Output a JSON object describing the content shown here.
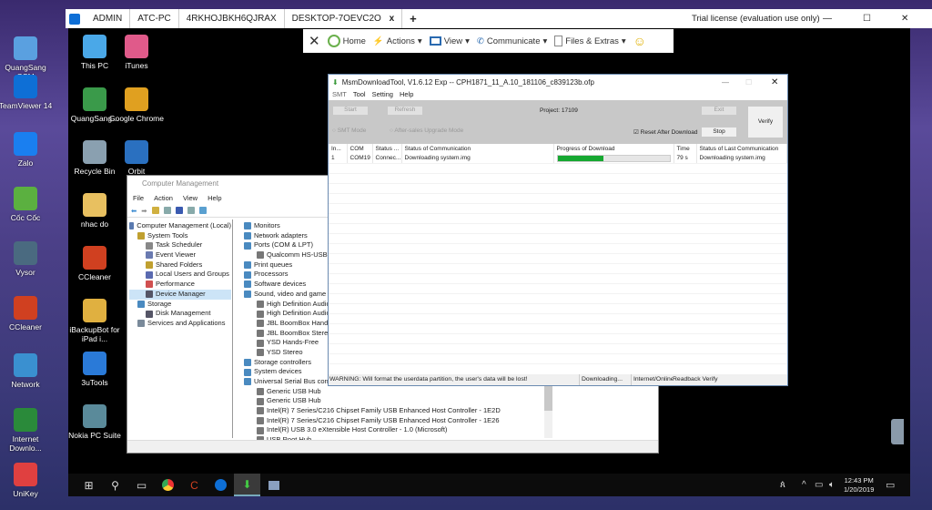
{
  "host_desktop": {
    "icons": [
      {
        "label": "QuangSang GSM",
        "color": "#5aa0e0"
      },
      {
        "label": "TeamViewer 14",
        "color": "#0e6fd6"
      },
      {
        "label": "Zalo",
        "color": "#1a7ff0"
      },
      {
        "label": "Cốc Cốc",
        "color": "#5bb040"
      },
      {
        "label": "Vysor",
        "color": "#4a6a80"
      },
      {
        "label": "CCleaner",
        "color": "#d04020"
      },
      {
        "label": "Network",
        "color": "#3a90d0"
      },
      {
        "label": "Internet Downlo...",
        "color": "#2a8a3a"
      },
      {
        "label": "UniKey",
        "color": "#e04040"
      }
    ]
  },
  "teamviewer": {
    "tabs": [
      "ADMIN",
      "ATC-PC",
      "4RKHOJBKH6QJRAX",
      "DESKTOP-7OEVC2O"
    ],
    "active_tab_close": "x",
    "new_tab": "+",
    "license": "Trial license (evaluation use only)",
    "toolbar": {
      "close": "✕",
      "home": "Home",
      "actions": "Actions",
      "view": "View",
      "communicate": "Communicate",
      "files": "Files & Extras",
      "emoji": "☺"
    }
  },
  "remote_desktop": {
    "icons": [
      {
        "label": "This PC",
        "color": "#4aa8e8"
      },
      {
        "label": "iTunes",
        "color": "#e05a8a"
      },
      {
        "label": "QuangSang...",
        "color": "#3a9a4a"
      },
      {
        "label": "Google Chrome",
        "color": "#e0a020"
      },
      {
        "label": "Recycle Bin",
        "color": "#8aa0b0"
      },
      {
        "label": "Orbit",
        "color": "#2a70c0"
      },
      {
        "label": "nhac do",
        "color": "#e8c060"
      },
      {
        "label": "CCleaner",
        "color": "#d04020"
      },
      {
        "label": "iBackupBot for iPad i...",
        "color": "#e0b040"
      },
      {
        "label": "3uTools",
        "color": "#2a7ad8"
      },
      {
        "label": "Nokia PC Suite",
        "color": "#5a8a9a"
      }
    ]
  },
  "computer_management": {
    "title": "Computer Management",
    "menu": [
      "File",
      "Action",
      "View",
      "Help"
    ],
    "tree": [
      {
        "label": "Computer Management (Local)",
        "level": 0
      },
      {
        "label": "System Tools",
        "level": 1
      },
      {
        "label": "Task Scheduler",
        "level": 2
      },
      {
        "label": "Event Viewer",
        "level": 2
      },
      {
        "label": "Shared Folders",
        "level": 2
      },
      {
        "label": "Local Users and Groups",
        "level": 2
      },
      {
        "label": "Performance",
        "level": 2
      },
      {
        "label": "Device Manager",
        "level": 2,
        "selected": true
      },
      {
        "label": "Storage",
        "level": 1
      },
      {
        "label": "Disk Management",
        "level": 2
      },
      {
        "label": "Services and Applications",
        "level": 1
      }
    ],
    "devices": [
      {
        "label": "Monitors",
        "level": 0
      },
      {
        "label": "Network adapters",
        "level": 0
      },
      {
        "label": "Ports (COM & LPT)",
        "level": 0
      },
      {
        "label": "Qualcomm HS-USB",
        "level": 1
      },
      {
        "label": "Print queues",
        "level": 0
      },
      {
        "label": "Processors",
        "level": 0
      },
      {
        "label": "Software devices",
        "level": 0
      },
      {
        "label": "Sound, video and game controllers",
        "level": 0
      },
      {
        "label": "High Definition Audio Device",
        "level": 1
      },
      {
        "label": "High Definition Audio Device",
        "level": 1
      },
      {
        "label": "JBL BoomBox Hands-Free",
        "level": 1
      },
      {
        "label": "JBL BoomBox Stereo",
        "level": 1
      },
      {
        "label": "YSD Hands-Free",
        "level": 1
      },
      {
        "label": "YSD Stereo",
        "level": 1
      },
      {
        "label": "Storage controllers",
        "level": 0
      },
      {
        "label": "System devices",
        "level": 0
      },
      {
        "label": "Universal Serial Bus controllers",
        "level": 0
      },
      {
        "label": "Generic USB Hub",
        "level": 1
      },
      {
        "label": "Generic USB Hub",
        "level": 1
      },
      {
        "label": "Intel(R) 7 Series/C216 Chipset Family USB Enhanced Host Controller - 1E2D",
        "level": 1
      },
      {
        "label": "Intel(R) 7 Series/C216 Chipset Family USB Enhanced Host Controller - 1E26",
        "level": 1
      },
      {
        "label": "Intel(R) USB 3.0 eXtensible Host Controller - 1.0 (Microsoft)",
        "level": 1
      },
      {
        "label": "USB Root Hub",
        "level": 1
      }
    ]
  },
  "msm": {
    "title": "MsmDownloadTool, V1.6.12 Exp -- CPH1871_11_A.10_181106_c839123b.ofp",
    "menu": [
      "SMT",
      "Tool",
      "Setting",
      "Help"
    ],
    "start": "Start",
    "refresh": "Refresh",
    "project": "Project: 17109",
    "exit": "Exit",
    "verify": "Verify",
    "stop": "Stop",
    "smt_mode": "SMT Mode",
    "aftersales_mode": "After-sales Upgrade Mode",
    "reset_after_download": "Reset After Download",
    "reset_checked": true,
    "columns": [
      "In...",
      "COM",
      "Status ...",
      "Status of Communication",
      "Progress of Download",
      "Time",
      "Status of Last Communication"
    ],
    "rows": [
      {
        "index": "1",
        "com": "COM19",
        "status": "Connec...",
        "comm": "Downloading system.img",
        "progress": 0.41,
        "time": "79 s",
        "last": "Downloading system.img"
      }
    ],
    "statusbar": [
      "WARNING: Will format the userdata partition, the user's data will be lost!",
      "Downloading...",
      "Internet/Online",
      "Readback Verify"
    ],
    "progress_color": "#16a831"
  },
  "taskbar": {
    "time": "12:43 PM",
    "date": "1/20/2019"
  }
}
